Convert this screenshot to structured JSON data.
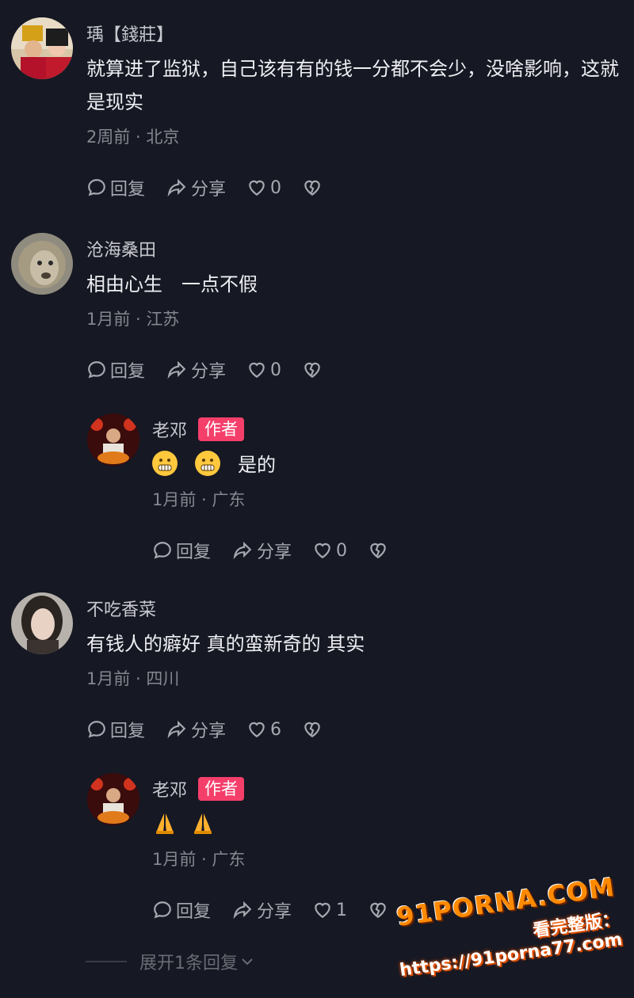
{
  "comments": [
    {
      "username": "瑀【錢莊】",
      "text": "就算进了监狱，自己该有有的钱一分都不会少，没啥影响，这就是现实",
      "meta": "2周前 · 北京",
      "reply_label": "回复",
      "share_label": "分享",
      "likes": "0"
    },
    {
      "username": "沧海桑田",
      "text": "相由心生　一点不假",
      "meta": "1月前 · 江苏",
      "reply_label": "回复",
      "share_label": "分享",
      "likes": "0"
    },
    {
      "username": "老邓",
      "badge": "作者",
      "text": "是的",
      "meta": "1月前 · 广东",
      "reply_label": "回复",
      "share_label": "分享",
      "likes": "0"
    },
    {
      "username": "不吃香菜",
      "text": "有钱人的癖好 真的蛮新奇的 其实",
      "meta": "1月前 · 四川",
      "reply_label": "回复",
      "share_label": "分享",
      "likes": "6"
    },
    {
      "username": "老邓",
      "badge": "作者",
      "text": "",
      "meta": "1月前 · 广东",
      "reply_label": "回复",
      "share_label": "分享",
      "likes": "1"
    }
  ],
  "expand_label": "展开1条回复",
  "watermark": {
    "brand": "91PORNA.COM",
    "sub": "看完整版：https://91porna77.com"
  },
  "icons": {
    "reply": "comment-bubble-icon",
    "share": "share-arrow-icon",
    "like": "heart-icon",
    "dislike": "broken-heart-icon",
    "expand": "chevron-down-icon"
  },
  "colors": {
    "background": "#161823",
    "author_badge": "#f53f6b",
    "watermark": "#ff8a00"
  }
}
